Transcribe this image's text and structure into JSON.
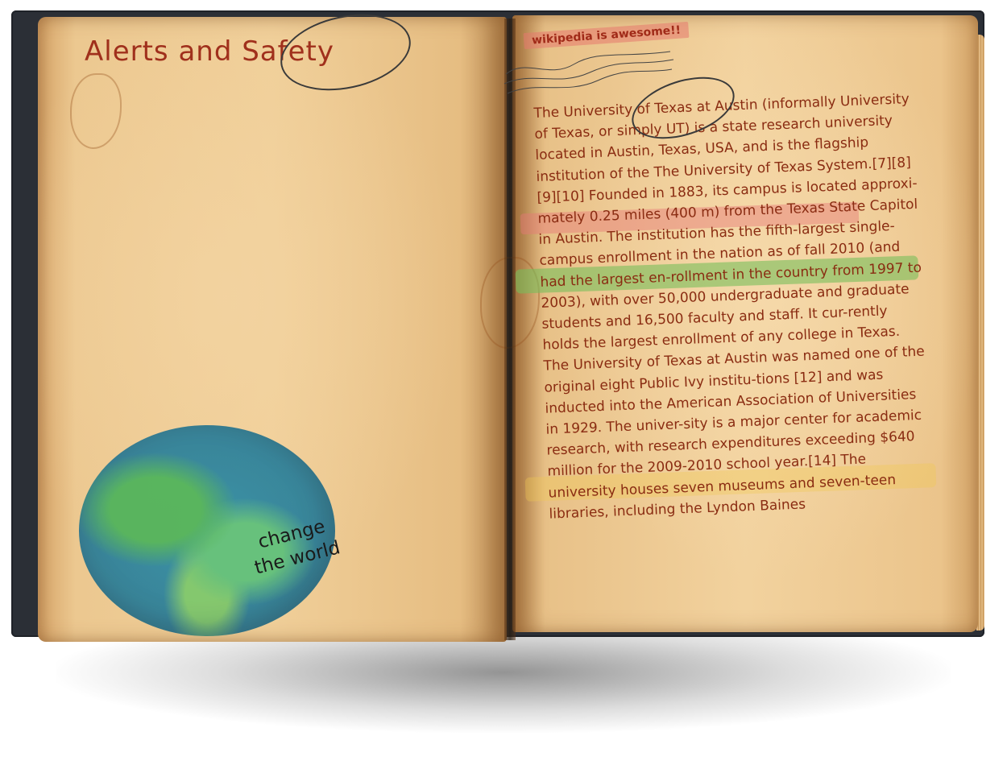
{
  "left_page": {
    "title": "Alerts and Safety",
    "globe_caption_line1": "change",
    "globe_caption_line2": "the world"
  },
  "right_page": {
    "sticky_note": "wikipedia is awesome!!",
    "paragraph1": "The University of Texas at Austin (informally University of Texas, or simply UT) is a state research university located in Austin, Texas, USA, and is the flagship institution of the The University of Texas System.[7][8][9][10] Founded in 1883, its campus is located approxi-mately 0.25 miles (400 m) from the Texas State Capitol in Austin. The institution has the fifth-largest single-campus enrollment in the nation as of fall 2010 (and had the largest en-rollment in the country from 1997 to 2003), with over 50,000 undergraduate and graduate students and 16,500 faculty and staff. It cur-rently holds the largest enrollment of any college in Texas.",
    "paragraph2": "The University of Texas at Austin was named one of the original eight Public Ivy institu-tions [12] and was inducted into the American Association of Universities in 1929. The univer-sity is a major center for academic research, with research expenditures exceeding $640 million for the 2009-2010 school year.[14] The university houses seven museums and seven-teen libraries, including the Lyndon Baines"
  },
  "colors": {
    "title": "#a0301c",
    "body_text": "#8a2c12",
    "highlight_green": "#78be5a",
    "highlight_red": "#e67878",
    "globe_ocean": "#2a7f9a",
    "globe_land": "#4db35a"
  }
}
